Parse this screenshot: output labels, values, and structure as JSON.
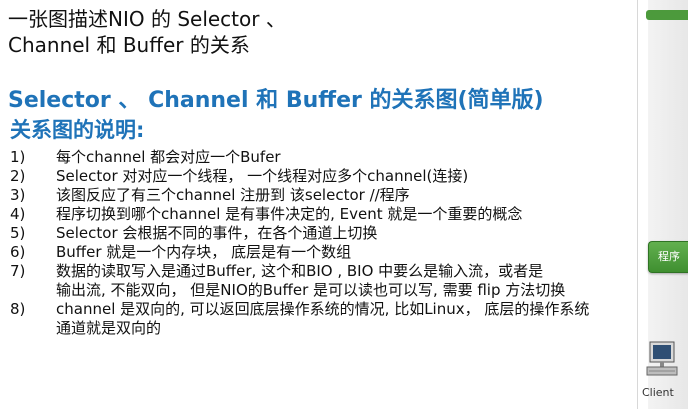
{
  "title": {
    "line1": "一张图描述NIO 的 Selector 、",
    "line2": "Channel  和 Buffer 的关系"
  },
  "subtitle": "Selector 、 Channel 和 Buffer 的关系图(简单版)",
  "section_heading": "关系图的说明:",
  "items": [
    {
      "num": "1)",
      "lines": [
        "每个channel 都会对应一个Bufer"
      ]
    },
    {
      "num": "2)",
      "lines": [
        "Selector 对对应一个线程， 一个线程对应多个channel(连接)"
      ]
    },
    {
      "num": "3)",
      "lines": [
        "该图反应了有三个channel 注册到 该selector //程序"
      ]
    },
    {
      "num": "4)",
      "lines": [
        "程序切换到哪个channel 是有事件决定的, Event 就是一个重要的概念"
      ]
    },
    {
      "num": "5)",
      "lines": [
        "Selector 会根据不同的事件，在各个通道上切换"
      ]
    },
    {
      "num": "6)",
      "lines": [
        "Buffer 就是一个内存块， 底层是有一个数组"
      ]
    },
    {
      "num": "7)",
      "lines": [
        "数据的读取写入是通过Buffer, 这个和BIO , BIO 中要么是输入流，或者是",
        "输出流, 不能双向， 但是NIO的Buffer 是可以读也可以写, 需要 flip 方法切换"
      ]
    },
    {
      "num": "8)",
      "lines": [
        "channel 是双向的, 可以返回底层操作系统的情况, 比如Linux， 底层的操作系统",
        "通道就是双向的"
      ]
    }
  ],
  "sidebar": {
    "button_label": "程序",
    "client_label": "Client"
  },
  "colors": {
    "heading_blue": "#1f73b8",
    "button_green": "#4c9a3c"
  }
}
